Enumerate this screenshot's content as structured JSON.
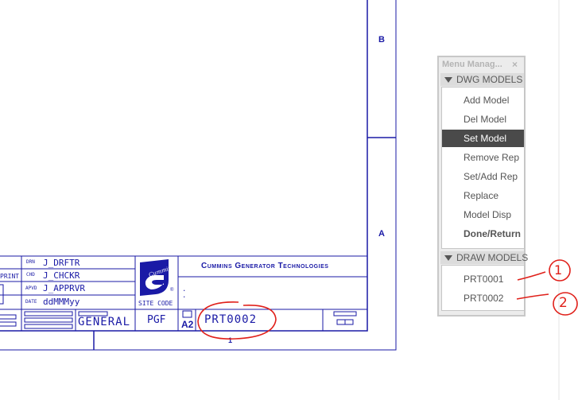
{
  "drawing": {
    "zone_labels": [
      "B",
      "A"
    ],
    "title_block": {
      "print_label": "PRINT",
      "drn_label": "DRN",
      "drn_value": "J_DRFTR",
      "chkd_label": "CHD",
      "chkd_value": "J_CHCKR",
      "apvd_label": "APVD",
      "apvd_value": "J_APPRVR",
      "date_label": "DATE",
      "date_value": "ddMMMyy",
      "general": "GENERAL",
      "site_code_label": "SITE CODE",
      "site_code_value": "PGF",
      "company_name": "Cummins Generator Technologies",
      "size": "A2",
      "part_number": "PRT0002",
      "sheet_number": "1",
      "dots": ".\n.",
      "logo_text": "Cummins"
    }
  },
  "menu_manager": {
    "title": "Menu Manag...",
    "close_symbol": "×",
    "sections": [
      {
        "header": "DWG MODELS",
        "items": [
          {
            "label": "Add Model",
            "selected": false,
            "bold": false
          },
          {
            "label": "Del Model",
            "selected": false,
            "bold": false
          },
          {
            "label": "Set Model",
            "selected": true,
            "bold": false
          },
          {
            "label": "Remove Rep",
            "selected": false,
            "bold": false
          },
          {
            "label": "Set/Add Rep",
            "selected": false,
            "bold": false
          },
          {
            "label": "Replace",
            "selected": false,
            "bold": false
          },
          {
            "label": "Model Disp",
            "selected": false,
            "bold": false
          },
          {
            "label": "Done/Return",
            "selected": false,
            "bold": true
          }
        ]
      },
      {
        "header": "DRAW MODELS",
        "items": [
          {
            "label": "PRT0001",
            "selected": false,
            "bold": false
          },
          {
            "label": "PRT0002",
            "selected": false,
            "bold": false
          }
        ]
      }
    ]
  },
  "annotations": {
    "labels": [
      "1",
      "2"
    ],
    "ink_color": "#e0201a"
  },
  "colors": {
    "drawing_line": "#1a1aa6",
    "selected_bg": "#4a4a4a",
    "panel_bg": "#ececec"
  }
}
